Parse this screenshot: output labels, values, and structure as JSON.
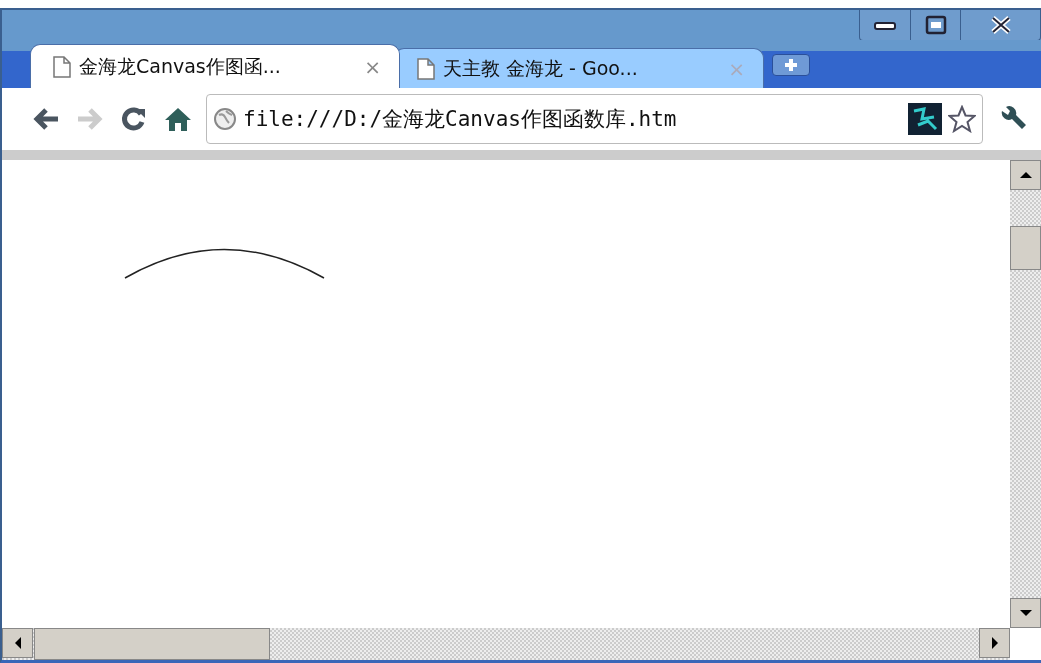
{
  "tabs": [
    {
      "title": "金海龙Canvas作图函...",
      "close": "×",
      "selected": true
    },
    {
      "title": "天主教 金海龙 - Goo...",
      "close": "×",
      "selected": false
    }
  ],
  "address": {
    "url": "file:///D:/金海龙Canvas作图函数库.htm"
  }
}
